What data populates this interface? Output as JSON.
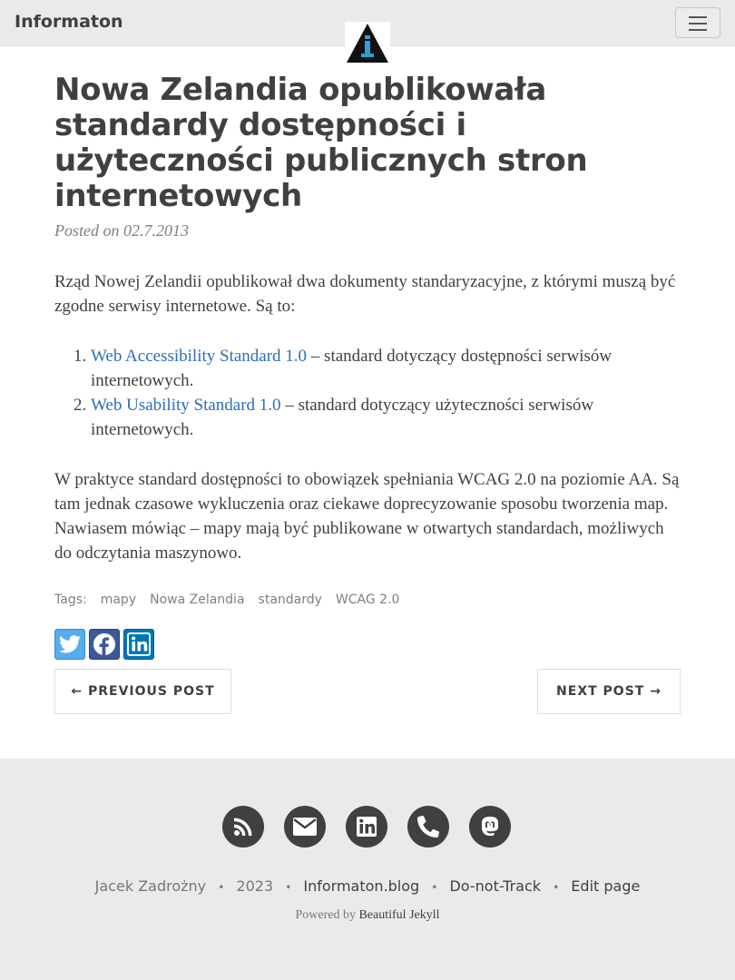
{
  "nav": {
    "brand": "Informaton",
    "logo_icon": "info-triangle-logo",
    "menu_icon": "hamburger-icon"
  },
  "post": {
    "title": "Nowa Zelandia opublikowała standardy dostępności i użyteczności publicznych stron internetowych",
    "meta": "Posted on 02.7.2013",
    "intro": "Rząd Nowej Zelandii opublikował dwa dokumenty standaryzacyjne, z którymi muszą być zgodne serwisy internetowe. Są to:",
    "list": [
      {
        "link": "Web Accessibility Standard 1.0",
        "rest": " – standard dotyczący dostępności serwisów internetowych."
      },
      {
        "link": "Web Usability Standard 1.0",
        "rest": " – standard dotyczący użyteczności serwisów internetowych."
      }
    ],
    "body": "W praktyce standard dostępności to obowiązek spełniania WCAG 2.0 na poziomie AA. Są tam jednak czasowe wykluczenia oraz ciekawe doprecyzowanie sposobu tworzenia map. Nawiasem mówiąc – mapy mają być publikowane w otwartych standardach, możliwych do odczytania maszynowo."
  },
  "tags": {
    "label": "Tags:",
    "items": [
      "mapy",
      "Nowa Zelandia",
      "standardy",
      "WCAG 2.0"
    ]
  },
  "share": {
    "twitter_icon": "twitter-icon",
    "facebook_icon": "facebook-icon",
    "linkedin_icon": "linkedin-icon"
  },
  "pager": {
    "prev": "← PREVIOUS POST",
    "next": "NEXT POST →"
  },
  "footer": {
    "icons": [
      "rss-icon",
      "email-icon",
      "linkedin-icon",
      "phone-icon",
      "mastodon-icon"
    ],
    "author": "Jacek Zadrożny",
    "year": "2023",
    "site": "Informaton.blog",
    "dnt": "Do-not-Track",
    "edit": "Edit page",
    "powered_prefix": "Powered by",
    "powered_link": "Beautiful Jekyll",
    "separator": "•"
  }
}
